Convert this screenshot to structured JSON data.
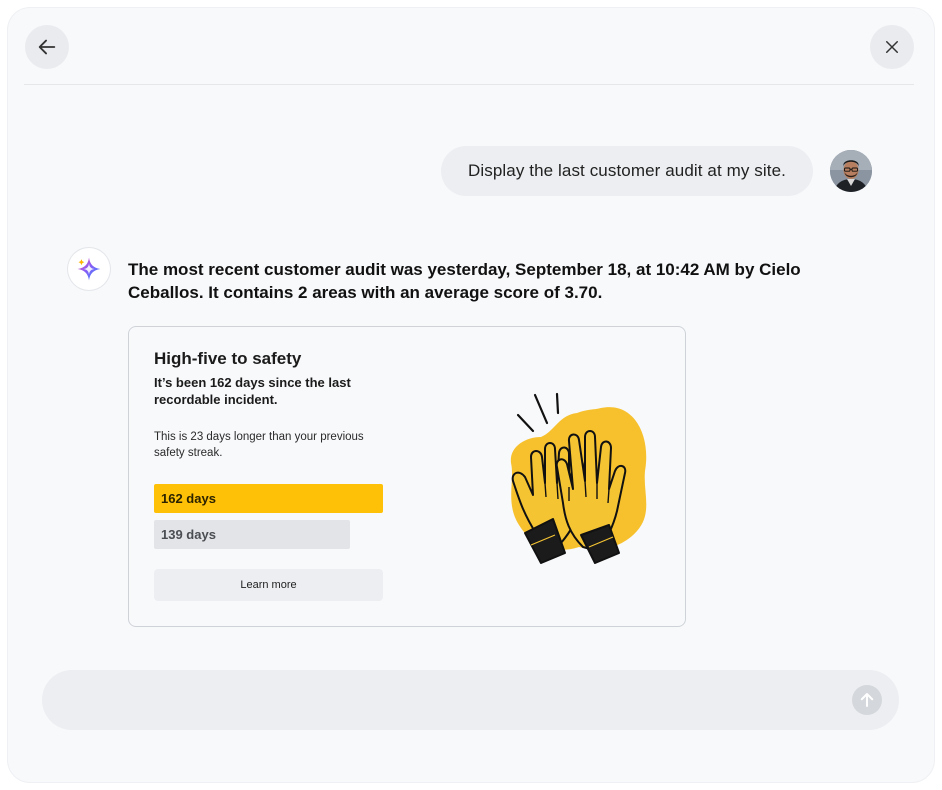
{
  "header": {
    "back_icon": "arrow-left-icon",
    "close_icon": "close-icon"
  },
  "conversation": {
    "user_message": "Display the last customer audit at my site.",
    "assistant_message": "The most recent customer audit was yesterday, September 18, at 10:42 AM  by Cielo Ceballos. It contains 2 areas with an average score of 3.70."
  },
  "card": {
    "title": "High-five to safety",
    "subtitle": "It’s been 162 days since the last recordable incident.",
    "description": "This is 23 days longer than your previous safety streak.",
    "bars": [
      {
        "label": "162 days",
        "value": 162,
        "color": "#ffc107"
      },
      {
        "label": "139 days",
        "value": 139,
        "color": "#e2e4e7"
      }
    ],
    "button_label": "Learn more",
    "illustration_icon": "high-five-hands-icon"
  },
  "composer": {
    "placeholder": "",
    "send_icon": "arrow-up-icon"
  }
}
